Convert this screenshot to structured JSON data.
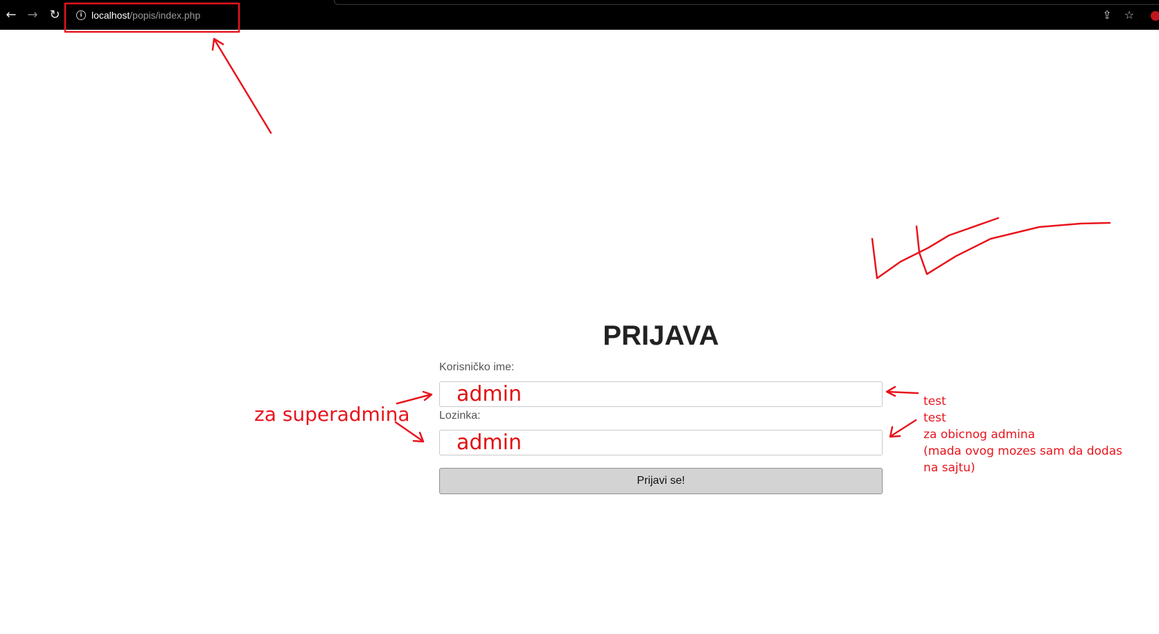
{
  "browser": {
    "back_icon": "arrow-left-icon",
    "forward_icon": "arrow-right-icon",
    "reload_icon": "reload-icon",
    "info_icon": "info-icon",
    "url_host": "localhost",
    "url_path": "/popis/index.php",
    "share_icon": "share-icon",
    "bookmark_icon": "star-icon",
    "extension_icon": "extension-icon"
  },
  "login": {
    "title": "PRIJAVA",
    "username_label": "Korisničko ime:",
    "username_value": "admin",
    "password_label": "Lozinka:",
    "password_value": "admin",
    "submit_label": "Prijavi se!"
  },
  "annotations": {
    "color": "#e8141c",
    "superadmin": "za superadmina",
    "note_lines": [
      "test",
      "test",
      "za obicnog admina",
      "(mada ovog mozes sam da dodas",
      "na sajtu)"
    ]
  }
}
